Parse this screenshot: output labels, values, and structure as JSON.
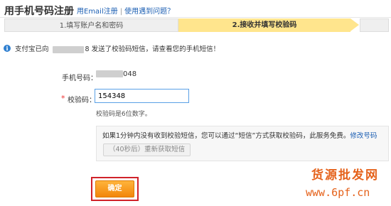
{
  "header": {
    "title": "用手机号码注册",
    "email_link": "用Email注册",
    "separator": "|",
    "help_link": "使用遇到问题？"
  },
  "steps": [
    {
      "label": "1.填写账户名和密码",
      "active": false
    },
    {
      "label": "2.接收并填写校验码",
      "active": true
    }
  ],
  "notice": {
    "icon": "info-icon",
    "prefix": "支付宝已向",
    "digit": "8",
    "suffix": "发送了校验码短信，请查看您的手机短信！"
  },
  "form": {
    "phone_label": "手机号码：",
    "phone_suffix": "048",
    "required_mark": "*",
    "code_label": "校验码：",
    "code_value": "154348",
    "hint": "校验码是6位数字。"
  },
  "resend": {
    "text": "如果1分钟内没有收到校验短信，您可以通过“短信”方式获取校验码，此服务免费。",
    "modify_link": "修改号码",
    "button_label": "（40秒后）重新获取短信"
  },
  "confirm": {
    "label": "确定",
    "highlight_color": "#d0222a"
  },
  "watermark": {
    "text_cn": "货源批发网",
    "url": "www.6pf.cn"
  },
  "colors": {
    "link": "#1c5fb3",
    "step_active_bg": "#ffe58d",
    "button_orange": "#f2860b"
  }
}
